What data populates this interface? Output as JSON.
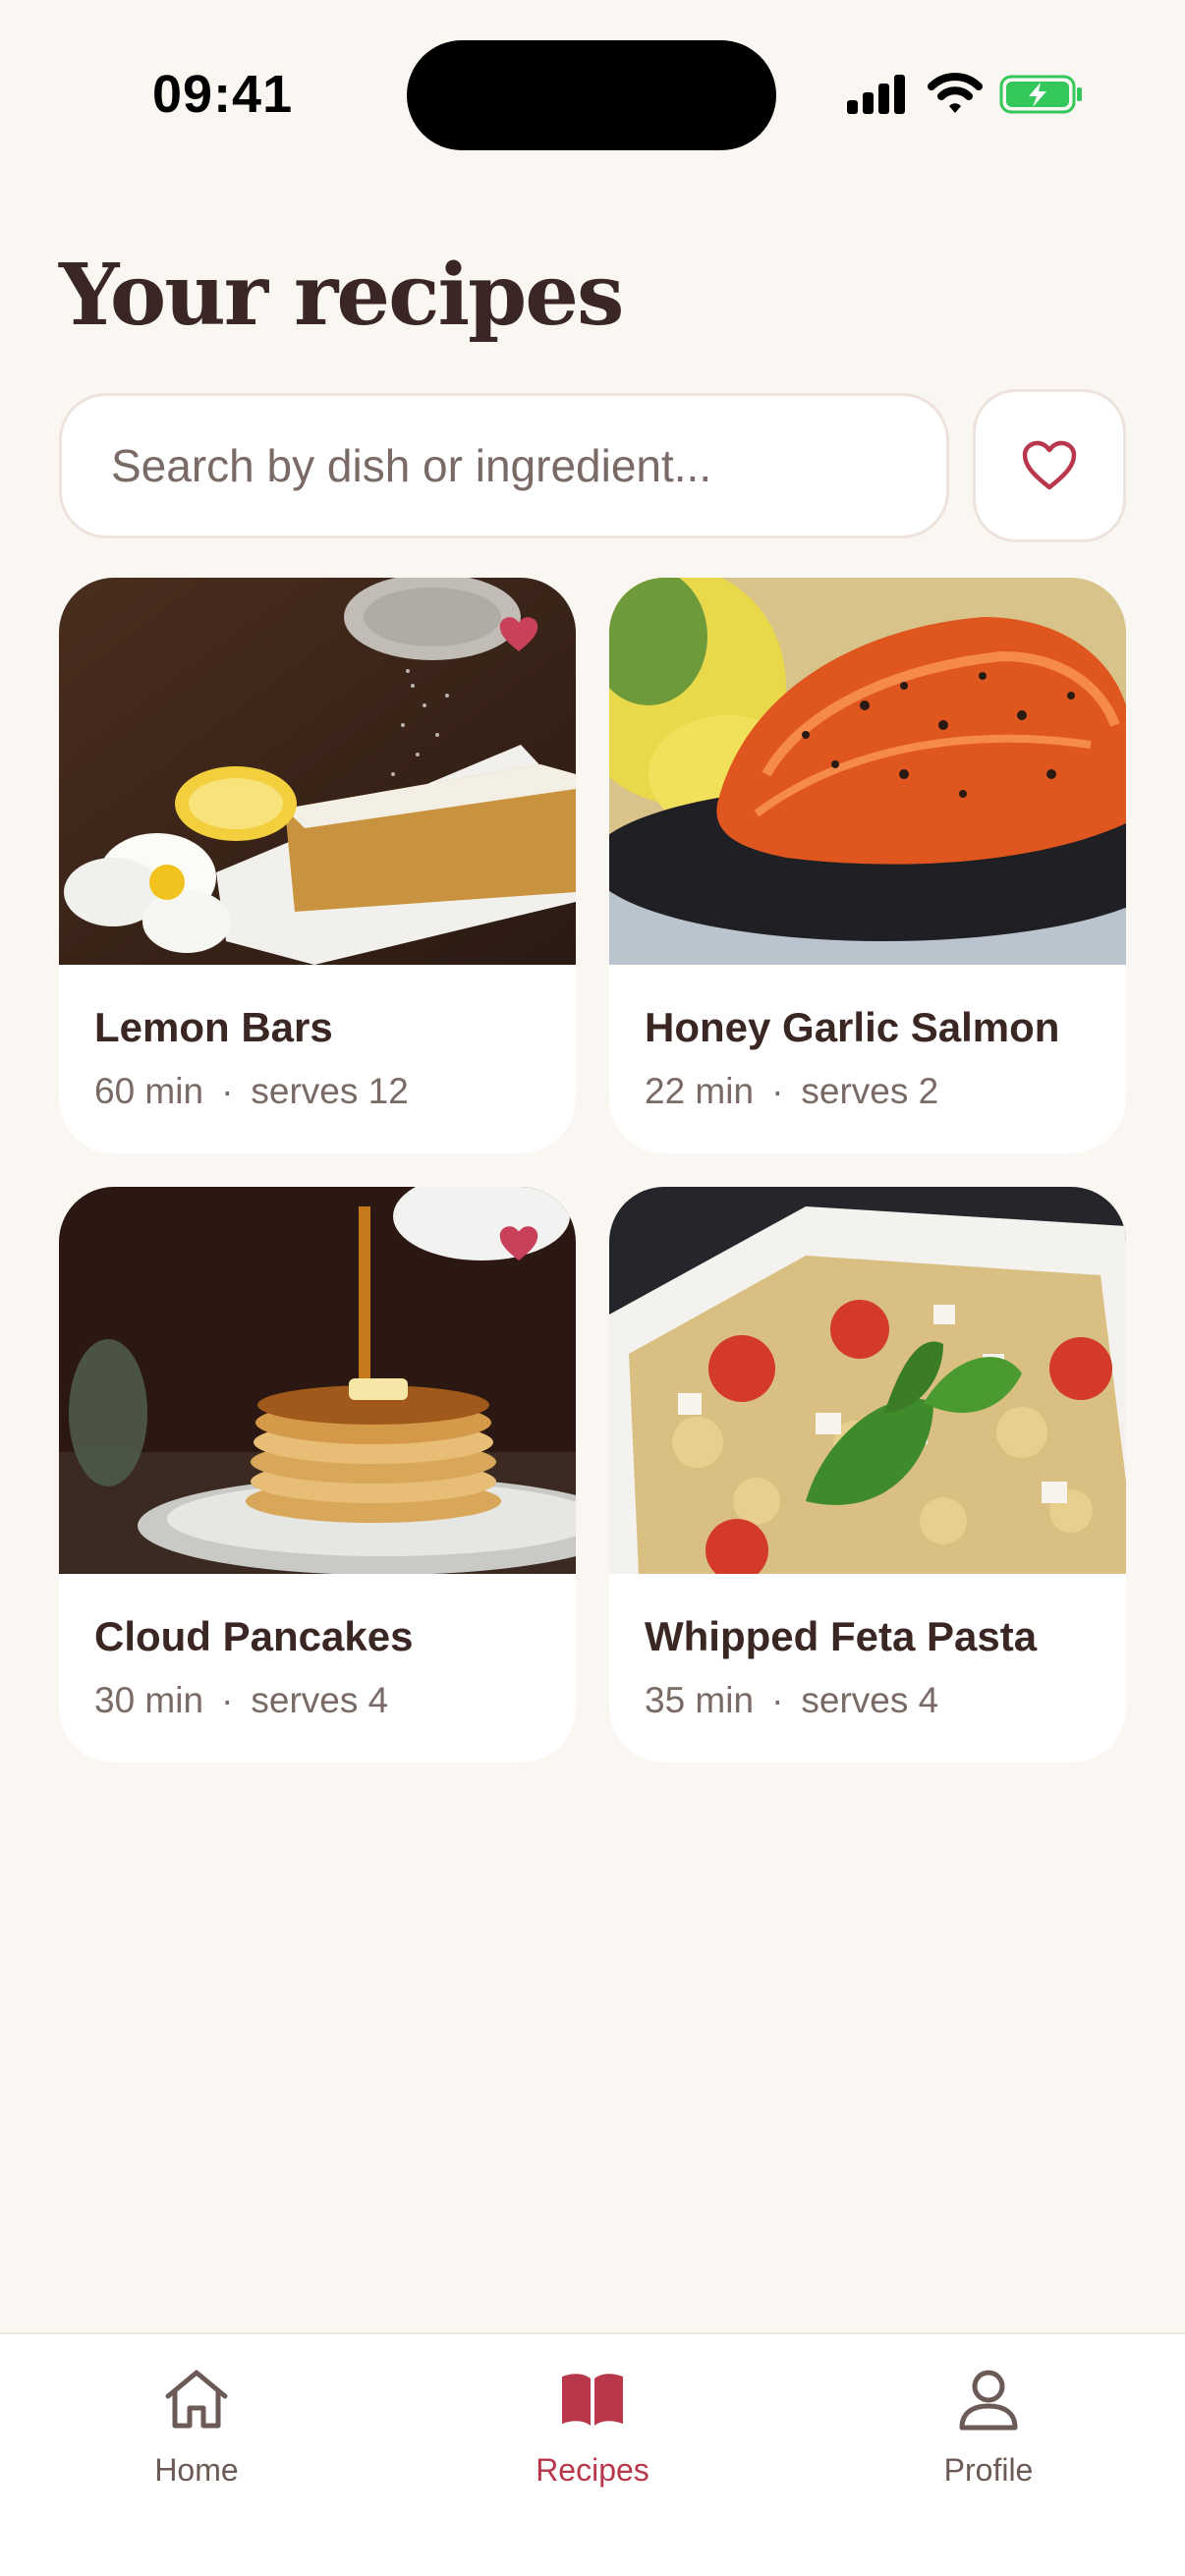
{
  "status_bar": {
    "time": "09:41"
  },
  "page": {
    "title": "Your recipes"
  },
  "search": {
    "placeholder": "Search by dish or ingredient..."
  },
  "accent_color": "#b8374b",
  "recipes": [
    {
      "title": "Lemon Bars",
      "time": "60 min",
      "serves": "serves 12",
      "favorite": true
    },
    {
      "title": "Honey Garlic Salmon",
      "time": "22 min",
      "serves": "serves 2",
      "favorite": false
    },
    {
      "title": "Cloud Pancakes",
      "time": "30 min",
      "serves": "serves 4",
      "favorite": true
    },
    {
      "title": "Whipped Feta Pasta",
      "time": "35 min",
      "serves": "serves 4",
      "favorite": false
    }
  ],
  "meta_separator": "·",
  "nav": {
    "items": [
      {
        "label": "Home",
        "icon": "home-icon"
      },
      {
        "label": "Recipes",
        "icon": "book-icon",
        "active": true
      },
      {
        "label": "Profile",
        "icon": "person-icon"
      }
    ]
  }
}
